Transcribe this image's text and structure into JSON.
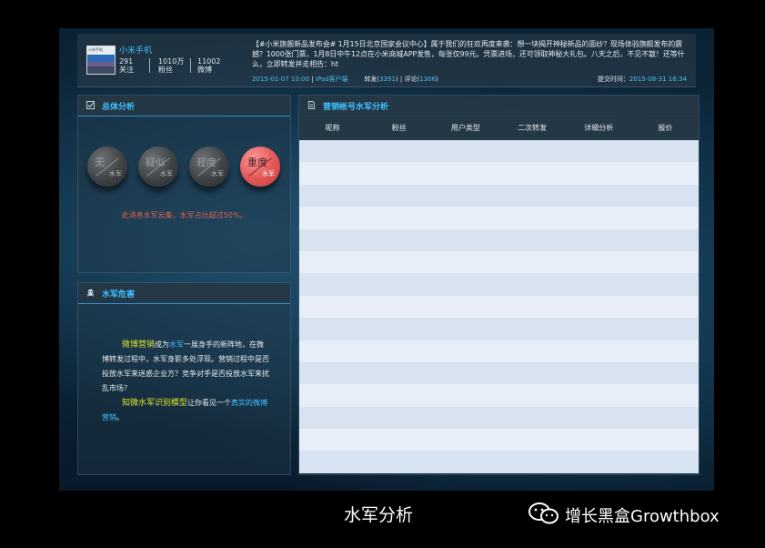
{
  "post": {
    "avatar_text": "小米手机",
    "account_name": "小米手机",
    "stats": [
      {
        "value": "291",
        "label": "关注"
      },
      {
        "value": "1010万",
        "label": "粉丝"
      },
      {
        "value": "11002",
        "label": "微博"
      }
    ],
    "content": "【#小米旗舰新品发布会# 1月15日北京国家会议中心】属于我们的狂欢再度来袭：想一块揭开神秘新品的面纱？现场体验旗舰发布的震撼？1000张门票，1月8日中午12点在小米商城APP发售，每张仅99元。凭票进场，还可领取神秘大礼包。八天之后，不见不散！还等什么，立即转发并走相告：ht",
    "time": "2015-01-07 10:00",
    "client": "iPad客户端",
    "repost_label": "转发",
    "repost_count": "3391",
    "comment_label": "评论",
    "comment_count": "1306",
    "submit_label": "提交时间：",
    "submit_time": "2015-08-31 16:34"
  },
  "overall": {
    "title": "总体分析",
    "levels": [
      {
        "top": "无",
        "bottom": "水军"
      },
      {
        "top": "疑似",
        "bottom": "水军"
      },
      {
        "top": "轻度",
        "bottom": "水军"
      },
      {
        "top": "重度",
        "bottom": "水军"
      }
    ],
    "active_level": "重度",
    "verdict": "此消息水军云集，水军占比超过50%。"
  },
  "risk": {
    "title": "水军危害",
    "p1_highlight": "微博营销",
    "p1_mid": "成为",
    "p1_blue": "水军",
    "p1_rest": "一展身手的新阵地，在微博转发过程中，水军身影多处浮现。营销过程中是否投放水军来迷惑企业方？竞争对手是否投放水军来扰乱市场？",
    "p2_highlight": "知微水军识别模型",
    "p2_mid": "让你看见一个",
    "p2_blue": "真实的微博营销",
    "p2_end": "。"
  },
  "table": {
    "title": "营销帐号水军分析",
    "columns": [
      "昵称",
      "粉丝",
      "用户类型",
      "二次转发",
      "详细分析",
      "报价"
    ],
    "rows": 15
  },
  "footer": {
    "caption": "水军分析",
    "brand": "增长黑盒Growthbox"
  }
}
